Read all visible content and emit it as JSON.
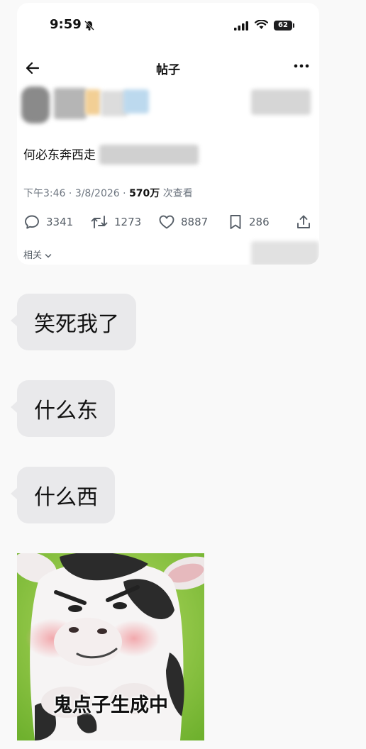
{
  "status_bar": {
    "time": "9:59",
    "battery": "62"
  },
  "nav": {
    "title": "帖子"
  },
  "post": {
    "text": "何必东奔西走",
    "time": "下午3:46",
    "date": "3/8/2026",
    "views_number": "570万",
    "views_label": "次查看",
    "replies": "3341",
    "reposts": "1273",
    "likes": "8887",
    "bookmarks": "286",
    "related": "相关"
  },
  "messages": [
    {
      "text": "笑死我了"
    },
    {
      "text": "什么东"
    },
    {
      "text": "什么西"
    }
  ],
  "sticker": {
    "caption": "鬼点子生成中"
  },
  "colors": {
    "bubble": "#e9e9eb",
    "page_background": "#f9f9f9",
    "meta_gray": "#6e7680"
  },
  "icons": [
    "bell-slash-icon",
    "signal-icon",
    "wifi-icon",
    "battery-icon",
    "back-arrow-icon",
    "more-icon",
    "reply-icon",
    "repost-icon",
    "like-icon",
    "bookmark-icon",
    "share-icon",
    "chevron-down-icon"
  ]
}
